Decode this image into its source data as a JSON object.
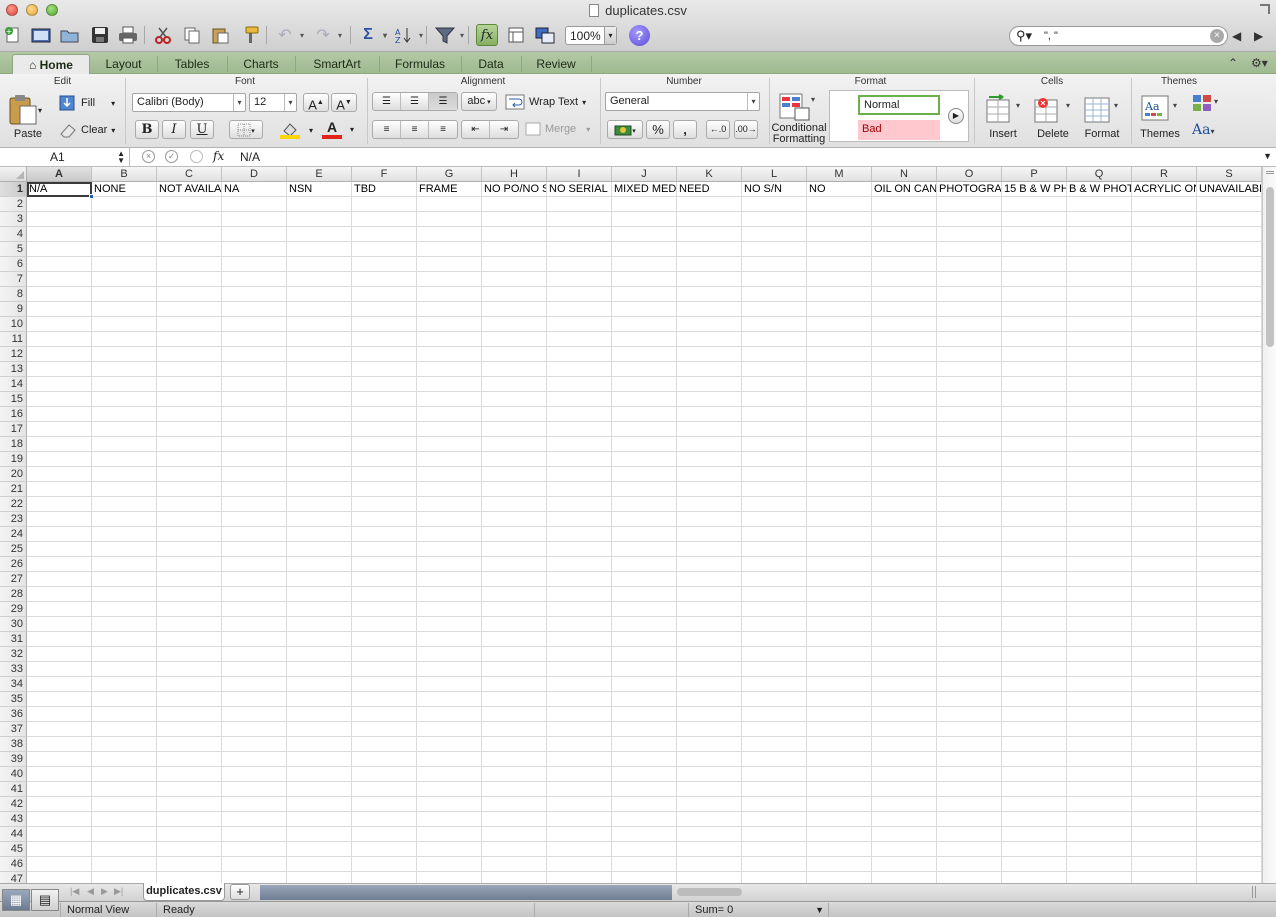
{
  "window": {
    "title": "duplicates.csv"
  },
  "toolbar": {
    "zoom": "100%",
    "search_value": "\", \"",
    "fx_label": "fx",
    "help_label": "?"
  },
  "tabs": [
    "Home",
    "Layout",
    "Tables",
    "Charts",
    "SmartArt",
    "Formulas",
    "Data",
    "Review"
  ],
  "ribbon": {
    "groups": {
      "edit": "Edit",
      "font": "Font",
      "alignment": "Alignment",
      "number": "Number",
      "format": "Format",
      "cells": "Cells",
      "themes": "Themes"
    },
    "paste": "Paste",
    "fill": "Fill",
    "clear": "Clear",
    "font_name": "Calibri (Body)",
    "font_size": "12",
    "bold": "B",
    "italic": "I",
    "underline": "U",
    "abc": "abc",
    "wrap_text": "Wrap Text",
    "merge": "Merge",
    "number_format": "General",
    "percent": "%",
    "comma": ",",
    "conditional_formatting_1": "Conditional",
    "conditional_formatting_2": "Formatting",
    "style_normal": "Normal",
    "style_bad": "Bad",
    "insert": "Insert",
    "delete": "Delete",
    "format": "Format",
    "themes": "Themes",
    "font_increase": "A",
    "font_decrease": "A",
    "font_color": "A",
    "theme_fonts": "Aa"
  },
  "formula_bar": {
    "name_box": "A1",
    "value": "N/A"
  },
  "grid": {
    "columns": [
      "A",
      "B",
      "C",
      "D",
      "E",
      "F",
      "G",
      "H",
      "I",
      "J",
      "K",
      "L",
      "M",
      "N",
      "O",
      "P",
      "Q",
      "R",
      "S"
    ],
    "rows": [
      "1",
      "2",
      "3",
      "4",
      "5",
      "6",
      "7",
      "8",
      "9",
      "10",
      "11",
      "12",
      "13",
      "14",
      "15",
      "16",
      "17",
      "18",
      "19",
      "20",
      "21",
      "22",
      "23",
      "24",
      "25",
      "26",
      "27",
      "28",
      "29",
      "30",
      "31",
      "32",
      "33",
      "34",
      "35",
      "36",
      "37",
      "38",
      "39",
      "40",
      "41",
      "42",
      "43",
      "44",
      "45",
      "46",
      "47"
    ],
    "row1": [
      "N/A",
      "NONE",
      "NOT AVAILA",
      "NA",
      "NSN",
      "TBD",
      "FRAME",
      "NO PO/NO S",
      "NO SERIAL N",
      "MIXED MEDI",
      "NEED",
      "NO S/N",
      "NO",
      "OIL ON CANV",
      "PHOTOGRAP",
      "15 B & W PH",
      "B & W PHOT",
      "ACRYLIC ON",
      "UNAVAILABL"
    ]
  },
  "sheets": {
    "active": "duplicates.csv",
    "add": "+"
  },
  "status": {
    "view": "Normal View",
    "state": "Ready",
    "sum": "Sum= 0"
  }
}
